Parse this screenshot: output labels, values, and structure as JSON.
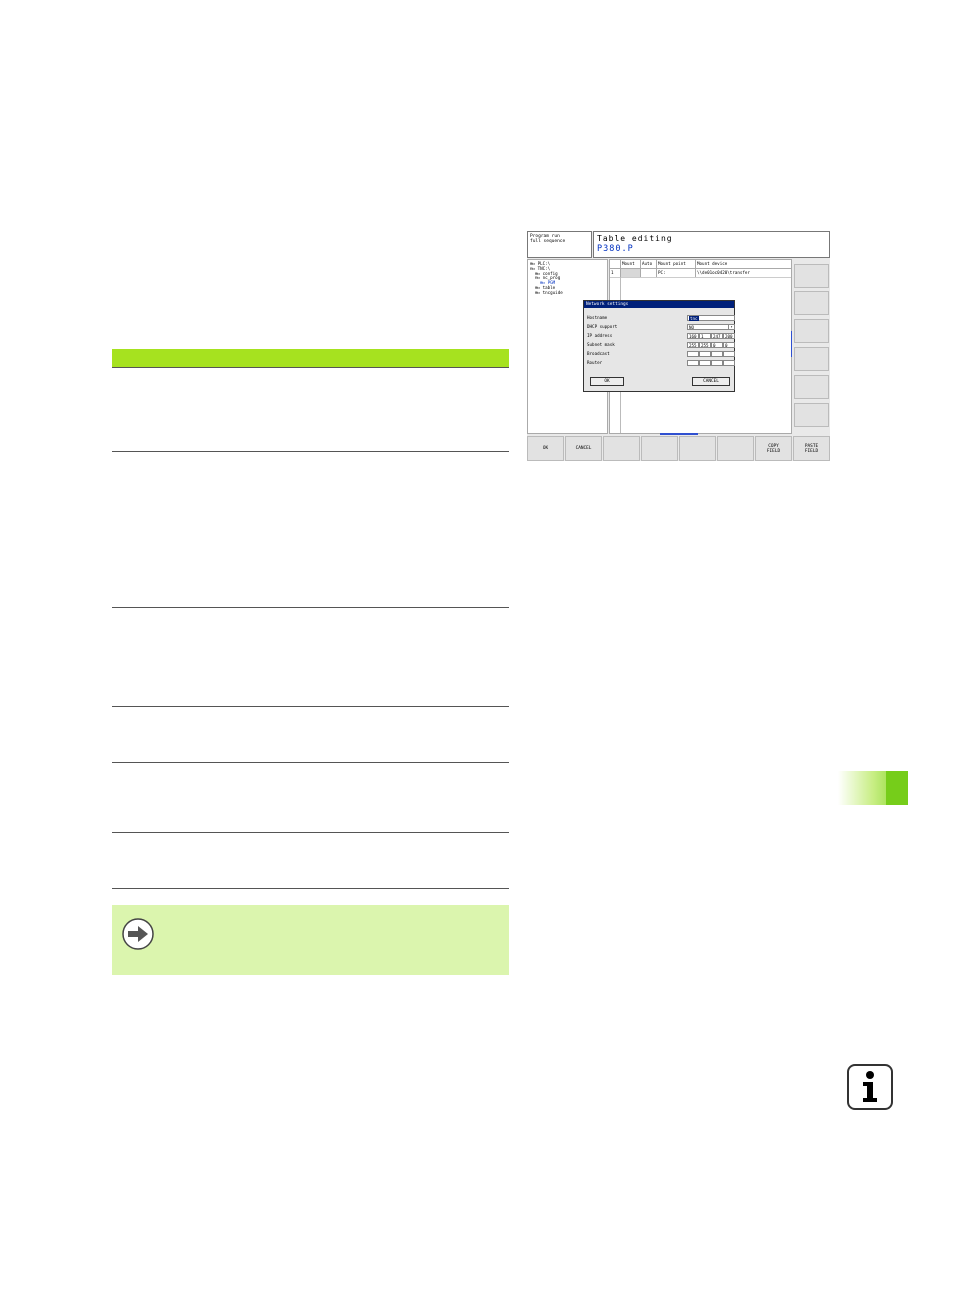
{
  "screen": {
    "mode": [
      "Program run",
      "full sequence"
    ],
    "title": "Table editing",
    "file": "P380.P",
    "tree": [
      "PLC:\\",
      "TNC:\\",
      "config",
      "nc_prog",
      "PGM",
      "table",
      "tncguide"
    ],
    "table": {
      "headers": [
        "",
        "Mount",
        "Auto",
        "Mount point",
        "Mount device"
      ],
      "rows": [
        [
          "1",
          "",
          "",
          "PC:",
          "\\\\de01oc0420\\transfer"
        ]
      ]
    },
    "dialog": {
      "title": "Network settings",
      "fields": {
        "hostname_label": "Hostname",
        "hostname_value": "tnc",
        "dhcp_label": "DHCP support",
        "dhcp_value": "NO",
        "ip_label": "IP address",
        "ip": [
          "160",
          "1",
          "247",
          "200"
        ],
        "subnet_label": "Subnet mask",
        "subnet": [
          "255",
          "255",
          "0",
          "0"
        ],
        "broadcast_label": "Broadcast",
        "router_label": "Router"
      },
      "ok_label": "OK",
      "cancel_label": "CANCEL"
    },
    "softkeys": {
      "ok": "OK",
      "cancel": "CANCEL",
      "copy_field": [
        "COPY",
        "FIELD"
      ],
      "paste_field": [
        "PASTE",
        "FIELD"
      ]
    }
  },
  "colors": {
    "accent_green": "#a6e21f",
    "note_background": "#dbf5ae",
    "dialog_title": "#00207a",
    "screen_blue_text": "#0030c0"
  }
}
